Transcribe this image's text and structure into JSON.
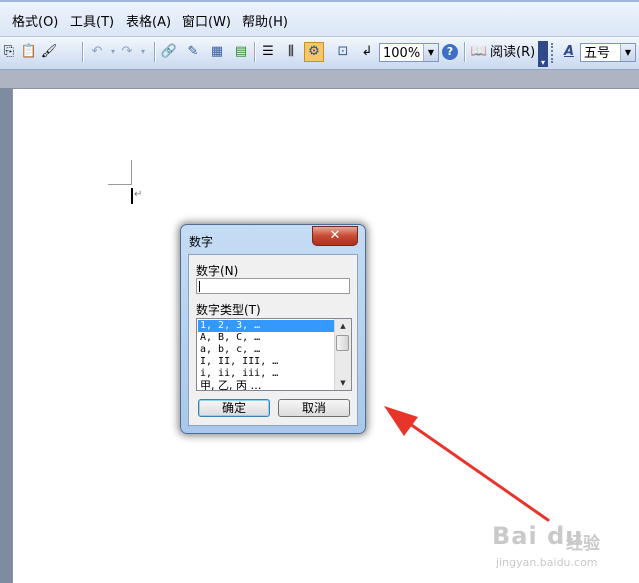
{
  "menu": {
    "items": [
      "格式(O)",
      "工具(T)",
      "表格(A)",
      "窗口(W)",
      "帮助(H)"
    ]
  },
  "toolbar": {
    "zoom_value": "100%",
    "reading_label": "阅读(R)",
    "font_size_value": "五号",
    "help_glyph": "?"
  },
  "document": {
    "paragraph_mark": "↵"
  },
  "dialog": {
    "title": "数字",
    "close_glyph": "✕",
    "number_label": "数字(N)",
    "number_value": "",
    "type_label": "数字类型(T)",
    "list_items": [
      "1, 2, 3, …",
      "A, B, C, …",
      "a, b, c, …",
      "I, II, III, …",
      "i, ii, iii, …",
      "甲, 乙, 丙 …"
    ],
    "selected_index": 0,
    "ok_label": "确定",
    "cancel_label": "取消"
  },
  "colors": {
    "annotation_arrow": "#e8352b",
    "selection": "#3399ff",
    "close_button": "#c74a33"
  },
  "watermark": {
    "brand": "Bai du",
    "suffix": "经验",
    "url": "jingyan.baidu.com"
  }
}
